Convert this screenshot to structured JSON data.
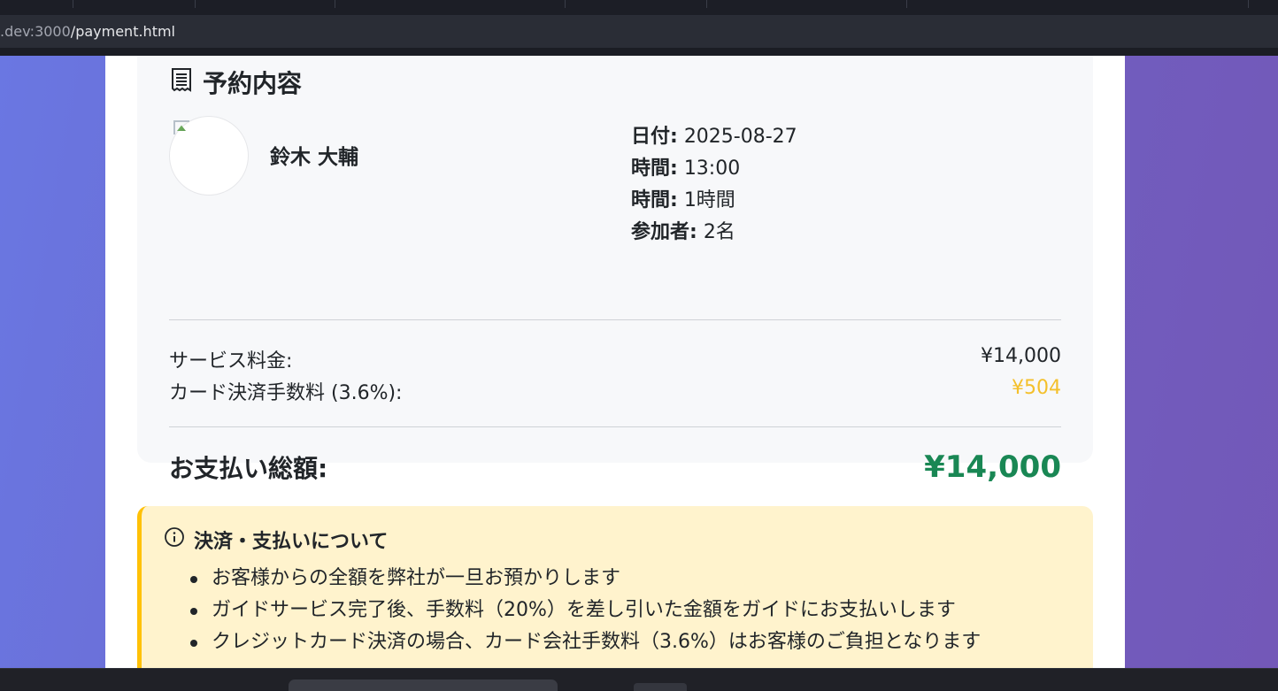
{
  "browser": {
    "url_host": ".dev:3000",
    "url_path": "/payment.html"
  },
  "summary": {
    "icon": "receipt-icon",
    "title": "予約内容",
    "guide_name": "鈴木 大輔",
    "details": [
      {
        "label": "日付:",
        "value": "2025-08-27"
      },
      {
        "label": "時間:",
        "value": "13:00"
      },
      {
        "label": "時間:",
        "value": "1時間"
      },
      {
        "label": "参加者:",
        "value": "2名"
      }
    ],
    "service_fee_label": "サービス料金:",
    "service_fee_value": "¥14,000",
    "card_fee_label": "カード決済手数料 (3.6%):",
    "card_fee_value": "¥504",
    "total_label": "お支払い総額:",
    "total_value": "¥14,000"
  },
  "info": {
    "icon": "info-circle-icon",
    "title": "決済・支払いについて",
    "items": [
      "お客様からの全額を弊社が一旦お預かりします",
      "ガイドサービス完了後、手数料（20%）を差し引いた金額をガイドにお支払いします",
      "クレジットカード決済の場合、カード会社手数料（3.6%）はお客様のご負担となります"
    ]
  },
  "colors": {
    "accent_total": "#198754",
    "accent_fee": "#f4c02b",
    "notice_border": "#ffc107",
    "notice_bg": "#fff3cd"
  }
}
